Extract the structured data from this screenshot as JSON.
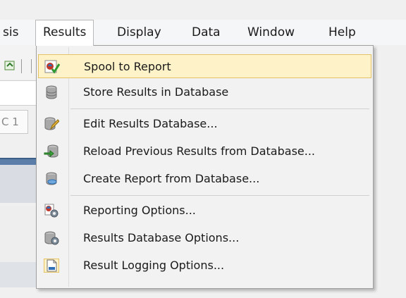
{
  "menubar": {
    "items": [
      {
        "label": "sis"
      },
      {
        "label": "Results"
      },
      {
        "label": "Display"
      },
      {
        "label": "Data"
      },
      {
        "label": "Window"
      },
      {
        "label": "Help"
      }
    ]
  },
  "background": {
    "field_text": "C 1"
  },
  "dropdown": {
    "items": [
      {
        "label": "Spool to Report",
        "icon": "spool-report-icon"
      },
      {
        "label": "Store Results in Database",
        "icon": "database-icon"
      },
      {
        "label": "Edit Results Database...",
        "icon": "edit-database-icon"
      },
      {
        "label": "Reload Previous Results from Database...",
        "icon": "reload-database-icon"
      },
      {
        "label": "Create Report from Database...",
        "icon": "create-report-icon"
      },
      {
        "label": "Reporting Options...",
        "icon": "reporting-options-icon"
      },
      {
        "label": "Results Database Options...",
        "icon": "database-options-icon"
      },
      {
        "label": "Result Logging Options...",
        "icon": "logging-options-icon"
      }
    ]
  },
  "colors": {
    "hover_fill": "#fdf2c8",
    "hover_border": "#e5c365"
  }
}
